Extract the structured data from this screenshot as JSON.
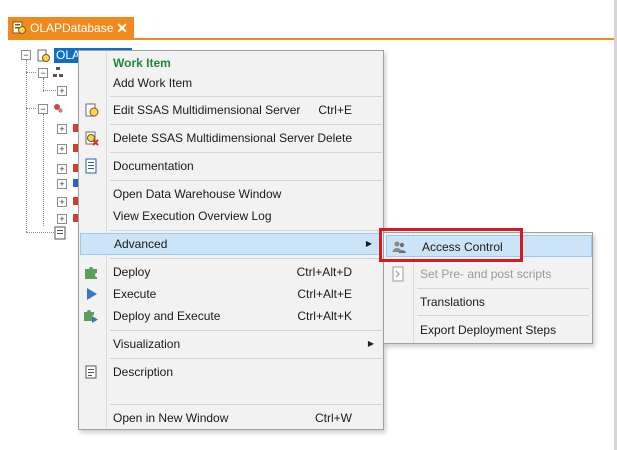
{
  "tab": {
    "title": "OLAPDatabase",
    "close_glyph": "✕",
    "accent": "#f18a1d"
  },
  "tree": {
    "selected_node_label": "OLAP"
  },
  "context_menu": {
    "items": [
      {
        "label": "Work Item",
        "shortcut": ""
      },
      {
        "label": "Add Work Item",
        "shortcut": ""
      },
      {
        "label": "Edit SSAS Multidimensional Server",
        "shortcut": "Ctrl+E"
      },
      {
        "label": "Delete SSAS Multidimensional Server",
        "shortcut": "Delete"
      },
      {
        "label": "Documentation",
        "shortcut": ""
      },
      {
        "label": "Open Data Warehouse Window",
        "shortcut": ""
      },
      {
        "label": "View Execution Overview Log",
        "shortcut": ""
      },
      {
        "label": "Advanced",
        "shortcut": ""
      },
      {
        "label": "Deploy",
        "shortcut": "Ctrl+Alt+D"
      },
      {
        "label": "Execute",
        "shortcut": "Ctrl+Alt+E"
      },
      {
        "label": "Deploy and Execute",
        "shortcut": "Ctrl+Alt+K"
      },
      {
        "label": "Visualization",
        "shortcut": ""
      },
      {
        "label": "Description",
        "shortcut": ""
      },
      {
        "label": "Open in New Window",
        "shortcut": "Ctrl+W"
      }
    ]
  },
  "submenu": {
    "items": [
      {
        "label": "Access Control",
        "icon": "users-icon"
      },
      {
        "label": "Set Pre- and post scripts",
        "icon": "script-icon"
      },
      {
        "label": "Translations",
        "icon": ""
      },
      {
        "label": "Export Deployment Steps",
        "icon": ""
      }
    ]
  },
  "colors": {
    "work_item_green": "#1e8a3a",
    "highlight_bg": "#cce4f7",
    "highlight_border": "#99c9ef",
    "annotation_red": "#d71920",
    "selection_blue": "#0f6fc6"
  }
}
